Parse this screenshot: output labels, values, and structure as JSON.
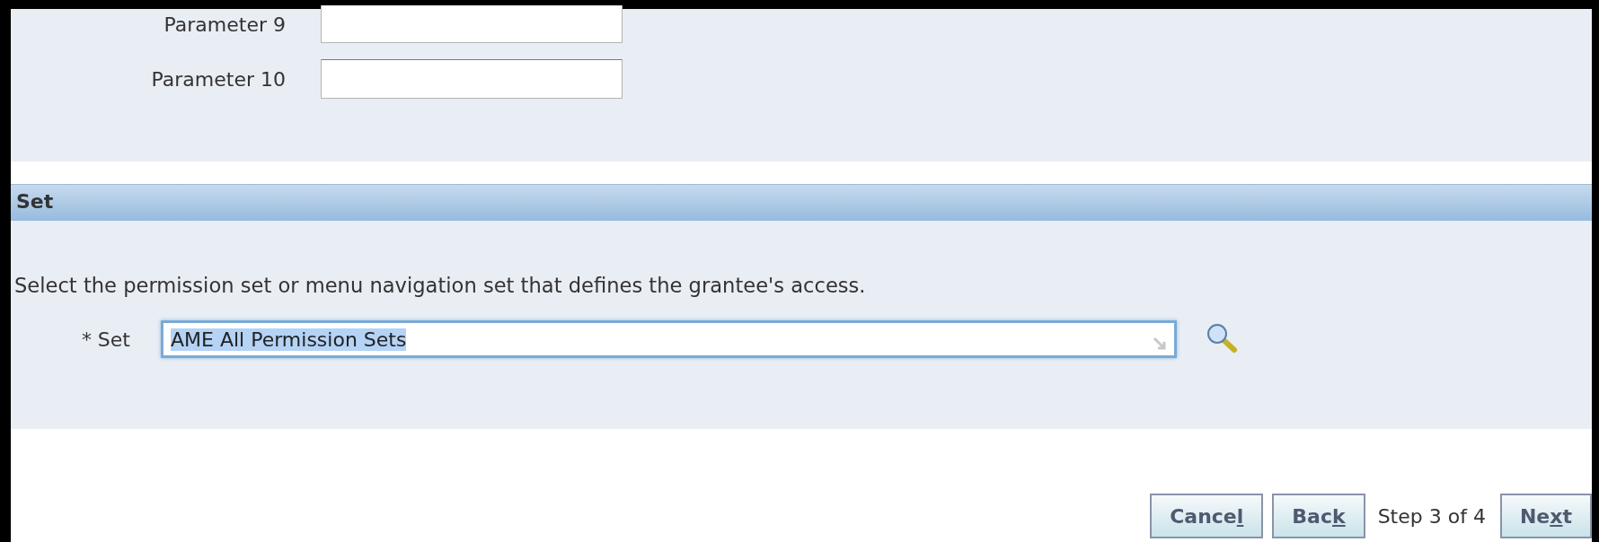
{
  "parameters": [
    {
      "label": "Parameter 9"
    },
    {
      "label": "Parameter 10"
    }
  ],
  "set_section": {
    "title": "Set",
    "instruction": "Select the permission set or menu navigation set that defines the grantee's access.",
    "field": {
      "required_mark": "*",
      "label": "Set",
      "value": "AME All Permission Sets",
      "value_selected": true,
      "focused": true
    }
  },
  "train": {
    "buttons": [
      {
        "text": "Cance",
        "underlined": "l"
      },
      {
        "text": "Bac",
        "underlined": "k"
      }
    ],
    "step": "Step 3 of 4",
    "next": {
      "text": "Ne",
      "underlined": "x",
      "after": "t"
    }
  }
}
